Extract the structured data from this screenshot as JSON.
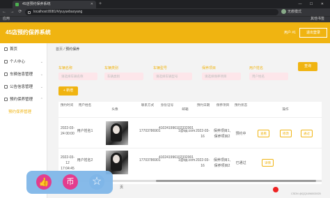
{
  "browser": {
    "tab_title": "45店预约保养系统",
    "url": "localhost:8081/#/yuyuebaoyang",
    "profile_label": "无痕模式",
    "bookmarks_apps": "应用",
    "bookmarks_other": "其他书签"
  },
  "header": {
    "title": "45店预约保养系统",
    "user": "用户 #1",
    "logout": "退出登录"
  },
  "sidebar": {
    "items": [
      {
        "label": "首页",
        "icon": "home-icon"
      },
      {
        "label": "个人中心",
        "icon": "user-icon"
      },
      {
        "label": "车辆信息管理",
        "icon": "car-icon"
      },
      {
        "label": "公告信息管理",
        "icon": "notice-icon"
      },
      {
        "label": "预约保养管理",
        "icon": "calendar-icon"
      },
      {
        "label": "预约保养管理",
        "icon": ""
      }
    ]
  },
  "breadcrumb": {
    "home": "首页",
    "current": "预约保养"
  },
  "filters": [
    {
      "label": "车辆名称",
      "placeholder": "请选择车辆名称"
    },
    {
      "label": "车辆类别",
      "placeholder": "车辆类别"
    },
    {
      "label": "车辆型号",
      "placeholder": "请选择车辆型号"
    },
    {
      "label": "保养项目",
      "placeholder": "请选择保养项目"
    },
    {
      "label": "用户姓名",
      "placeholder": "用户姓名"
    }
  ],
  "buttons": {
    "search": "查询",
    "add": "+ 新增"
  },
  "table": {
    "headers": [
      "预约时间",
      "用户姓名",
      "头像",
      "联系方式",
      "身份证号",
      "邮箱",
      "预约日期",
      "保养项目",
      "预约状态",
      "操作"
    ],
    "rows": [
      {
        "time": "2022-03-24 00:00",
        "user": "用户姓名1",
        "phone": "17703786901",
        "idcard": "410241996102332001",
        "email": "1@qq.com",
        "date": "2022-03-16",
        "item": "保养项目1,保养项目2",
        "status": "预约中",
        "actions": [
          "查看",
          "修改",
          "通过"
        ]
      },
      {
        "time": "2022-03-12 17:04:45",
        "user": "用户姓名2",
        "phone": "17703786901",
        "idcard": "410241996102332001",
        "email": "1@qq.com",
        "date": "2022-03-16",
        "item": "保养项目1,保养项目2",
        "status": "已通过",
        "actions": [
          "详情"
        ]
      }
    ]
  },
  "pagination": {
    "text": "页"
  },
  "watermark": "CSDN @QQ1696003925",
  "floatbar": {
    "icons": [
      "thumbs-up-icon",
      "coin-icon",
      "star-icon"
    ]
  }
}
